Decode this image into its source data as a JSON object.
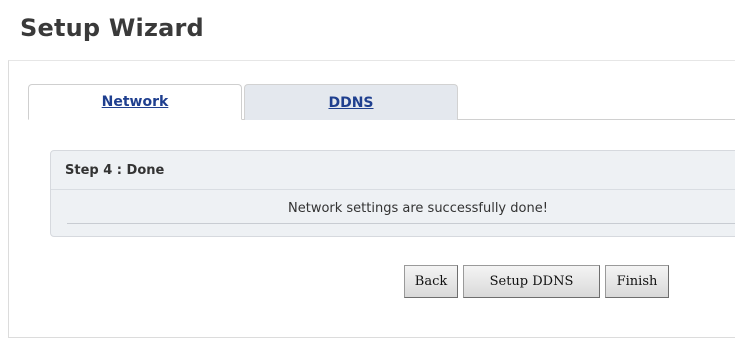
{
  "header": {
    "title": "Setup Wizard"
  },
  "tabs": [
    {
      "label": "Network",
      "active": true
    },
    {
      "label": "DDNS",
      "active": false
    }
  ],
  "step": {
    "title": "Step 4 : Done",
    "message": "Network settings are successfully done!"
  },
  "buttons": {
    "back": "Back",
    "setup_ddns": "Setup DDNS",
    "finish": "Finish"
  },
  "colors": {
    "tab_link": "#1f3f8f",
    "panel_background": "#eef1f4",
    "inactive_tab_background": "#e4e8ee"
  }
}
